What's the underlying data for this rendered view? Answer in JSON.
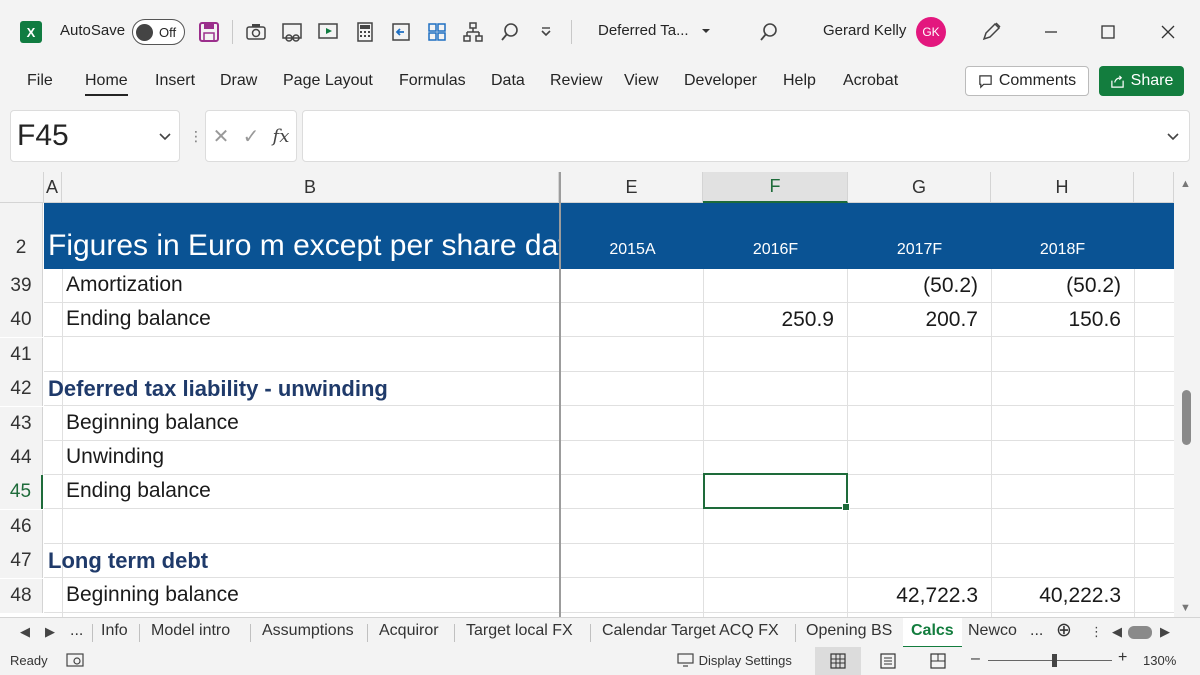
{
  "titlebar": {
    "autosave_label": "AutoSave",
    "autosave_state": "Off",
    "doc_title": "Deferred Ta...",
    "user_name": "Gerard Kelly",
    "user_initials": "GK"
  },
  "menu": {
    "items": [
      "File",
      "Home",
      "Insert",
      "Draw",
      "Page Layout",
      "Formulas",
      "Data",
      "Review",
      "View",
      "Developer",
      "Help",
      "Acrobat"
    ],
    "active": "Home",
    "comments_label": "Comments",
    "share_label": "Share"
  },
  "formula_bar": {
    "name_box": "F45",
    "fx_label": "fx",
    "formula": ""
  },
  "columns": [
    "A",
    "B",
    "E",
    "F",
    "G",
    "H"
  ],
  "selected_column": "F",
  "header_band": {
    "row": "2",
    "title": "Figures in Euro m except per share data",
    "years": [
      "2015A",
      "2016F",
      "2017F",
      "2018F"
    ]
  },
  "rows": [
    {
      "num": "39",
      "label": "Amortization",
      "style": "text",
      "E": "",
      "F": "",
      "G": "(50.2)",
      "H": "(50.2)"
    },
    {
      "num": "40",
      "label": "Ending balance",
      "style": "text",
      "E": "",
      "F": "250.9",
      "G": "200.7",
      "H": "150.6"
    },
    {
      "num": "41",
      "label": "",
      "style": "text",
      "E": "",
      "F": "",
      "G": "",
      "H": ""
    },
    {
      "num": "42",
      "label": "Deferred tax liability - unwinding",
      "style": "heading",
      "E": "",
      "F": "",
      "G": "",
      "H": ""
    },
    {
      "num": "43",
      "label": "Beginning balance",
      "style": "text",
      "E": "",
      "F": "",
      "G": "",
      "H": ""
    },
    {
      "num": "44",
      "label": "Unwinding",
      "style": "text",
      "E": "",
      "F": "",
      "G": "",
      "H": ""
    },
    {
      "num": "45",
      "label": "Ending balance",
      "style": "text",
      "E": "",
      "F": "",
      "G": "",
      "H": ""
    },
    {
      "num": "46",
      "label": "",
      "style": "text",
      "E": "",
      "F": "",
      "G": "",
      "H": ""
    },
    {
      "num": "47",
      "label": "Long term debt",
      "style": "heading",
      "E": "",
      "F": "",
      "G": "",
      "H": ""
    },
    {
      "num": "48",
      "label": "Beginning balance",
      "style": "text",
      "E": "",
      "F": "",
      "G": "42,722.3",
      "H": "40,222.3"
    }
  ],
  "selected_row": "45",
  "sheet_tabs": {
    "items": [
      "...",
      "Info",
      "Model intro",
      "Assumptions",
      "Acquiror",
      "Target local FX",
      "Calendar Target ACQ FX",
      "Opening BS",
      "Calcs",
      "Newco",
      "..."
    ],
    "active": "Calcs"
  },
  "status": {
    "ready": "Ready",
    "display_settings": "Display Settings",
    "zoom": "130%"
  },
  "colors": {
    "band": "#0a5394",
    "accent_green": "#137d3e",
    "heading_text": "#1f3a6a",
    "avatar": "#e3177e"
  }
}
